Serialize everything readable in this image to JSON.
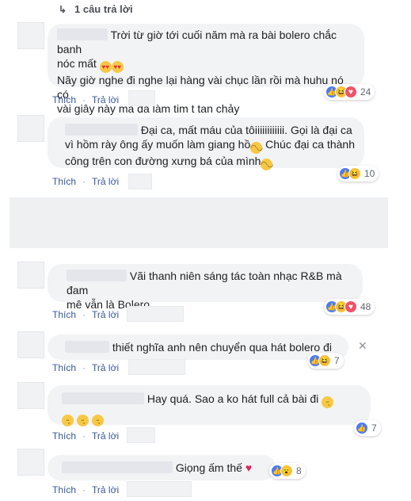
{
  "replies_link": "1 câu trả lời",
  "action_like": "Thích",
  "action_reply": "Trả lời",
  "comments": [
    {
      "lines": [
        "Trời từ giờ tới cuối năm mà ra bài bolero chắc banh",
        "nóc mất",
        "Nãy giờ nghe đi nghe lại hàng vài chục lần rồi mà huhu nó có",
        "vài giây này mà đã làm tim t tan chảy"
      ],
      "reaction_count": "24",
      "reactions": [
        "like-icon",
        "haha-icon",
        "love-icon"
      ]
    },
    {
      "lines": [
        "Đại ca, mất máu của tôiiiiiiiiiiii. Gọi là đại ca",
        "vì hồm rày ông ấy muốn làm giang hồ",
        " Chúc đại ca thành",
        "công trên con đường xưng bá của mình"
      ],
      "reaction_count": "10",
      "reactions": [
        "like-icon",
        "haha-icon"
      ]
    },
    {
      "lines": [
        "Vãi thanh niên sáng tác toàn nhạc R&B mà đam",
        "mê vẫn là Bolero"
      ],
      "reaction_count": "48",
      "reactions": [
        "like-icon",
        "haha-icon",
        "love-icon"
      ]
    },
    {
      "lines": [
        "thiết nghĩa anh nên chuyển qua hát bolero đi"
      ],
      "reaction_count": "7",
      "reactions": [
        "like-icon",
        "haha-icon"
      ]
    },
    {
      "lines": [
        "Hay quá. Sao a ko hát full cả bài đi"
      ],
      "reaction_count": "7",
      "reactions": [
        "like-icon"
      ]
    },
    {
      "lines": [
        "Giọng ấm thế"
      ],
      "reaction_count": "8",
      "reactions": [
        "like-icon",
        "wow-icon"
      ]
    }
  ]
}
